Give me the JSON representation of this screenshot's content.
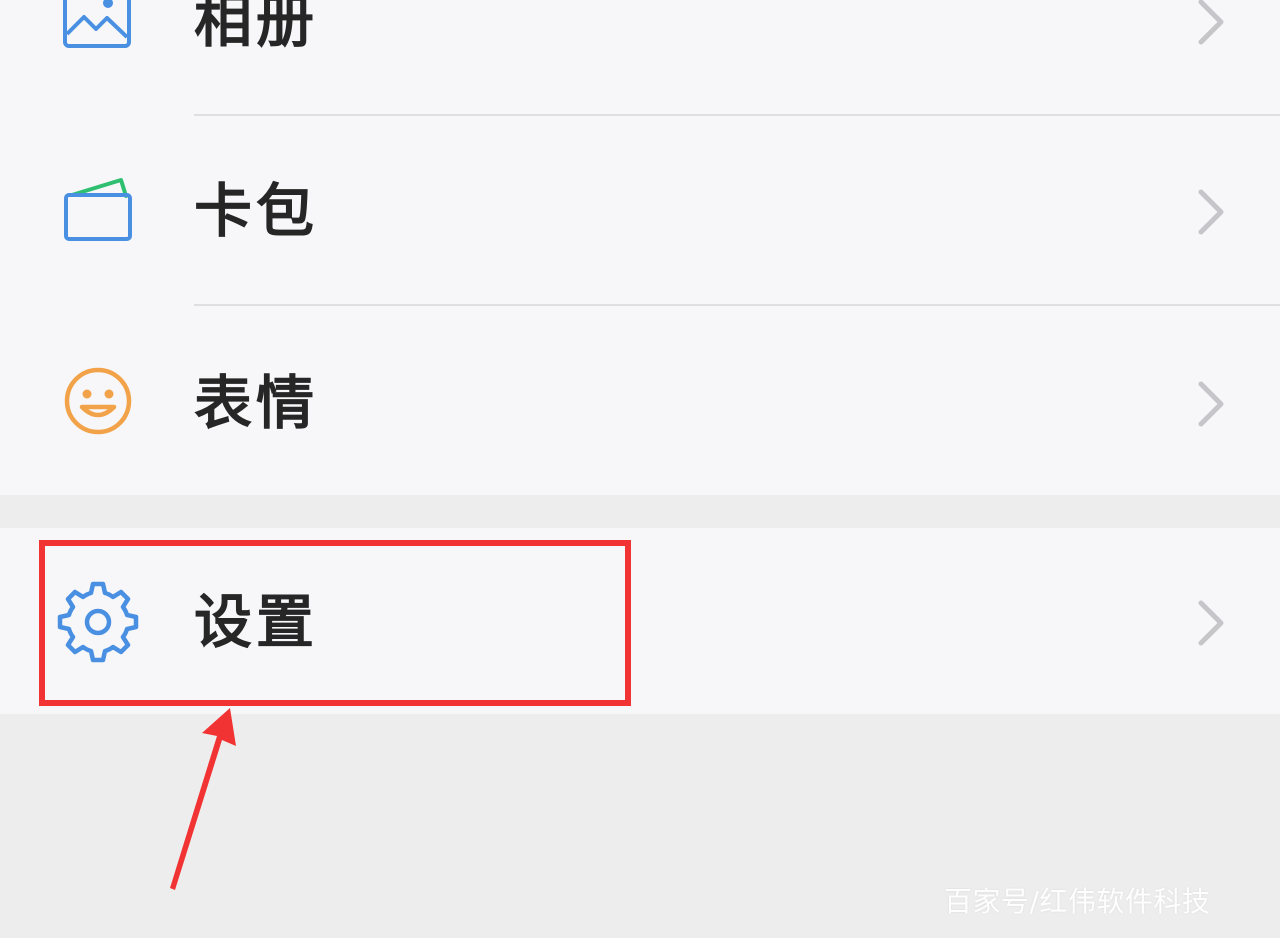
{
  "menu": {
    "items": [
      {
        "label": "相册",
        "icon": "photo-album-icon",
        "icon_color": "#4a90e2"
      },
      {
        "label": "卡包",
        "icon": "card-wallet-icon",
        "icon_color": "#4a90e2",
        "accent_color": "#2fbf71"
      },
      {
        "label": "表情",
        "icon": "smiley-icon",
        "icon_color": "#f2a349"
      },
      {
        "label": "设置",
        "icon": "gear-icon",
        "icon_color": "#4a90e2"
      }
    ]
  },
  "annotation": {
    "highlight_color": "#f23333"
  },
  "watermark": {
    "text": "百家号/红伟软件科技"
  }
}
